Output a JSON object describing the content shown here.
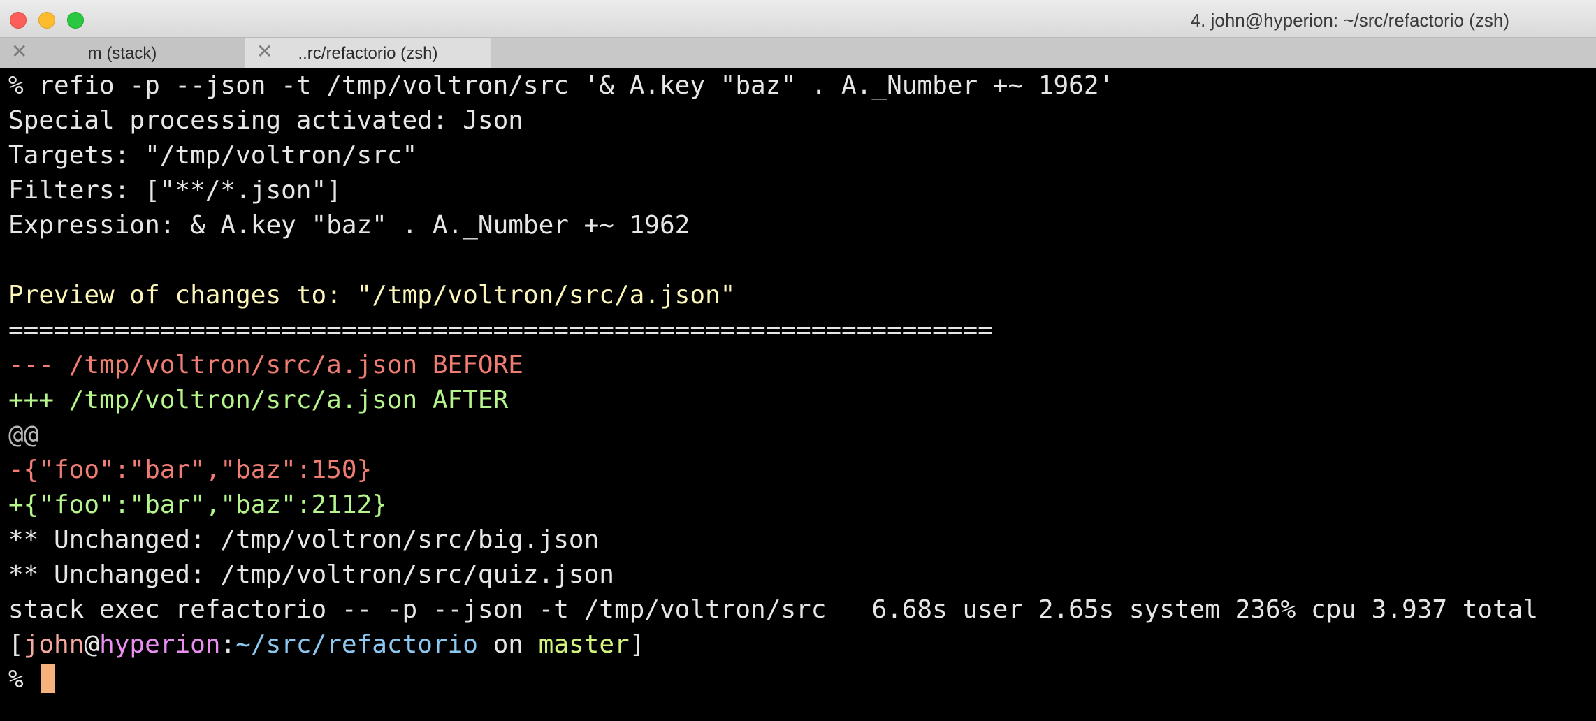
{
  "window": {
    "title": "4. john@hyperion: ~/src/refactorio (zsh)"
  },
  "tabs": [
    {
      "label": "m (stack)",
      "close": "✕"
    },
    {
      "label": "..rc/refactorio (zsh)",
      "close": "✕"
    }
  ],
  "terminal": {
    "lines": [
      "% refio -p --json -t /tmp/voltron/src '& A.key \"baz\" . A._Number +~ 1962'",
      "Special processing activated: Json",
      "Targets: \"/tmp/voltron/src\"",
      "Filters: [\"**/*.json\"]",
      "Expression: & A.key \"baz\" . A._Number +~ 1962",
      "",
      "Preview of changes to: \"/tmp/voltron/src/a.json\"",
      "=================================================================",
      "--- /tmp/voltron/src/a.json BEFORE",
      "+++ /tmp/voltron/src/a.json AFTER",
      "@@",
      "-{\"foo\":\"bar\",\"baz\":150}",
      "+{\"foo\":\"bar\",\"baz\":2112}",
      "** Unchanged: /tmp/voltron/src/big.json",
      "** Unchanged: /tmp/voltron/src/quiz.json",
      "stack exec refactorio -- -p --json -t /tmp/voltron/src   6.68s user 2.65s system 236% cpu 3.937 total"
    ],
    "prompt": {
      "open": "[",
      "user": "john",
      "at": "@",
      "host": "hyperion",
      "sep": ":",
      "path": "~/src/refactorio",
      "on": " on ",
      "branch": "master",
      "close": "]"
    },
    "input_prompt": "% "
  },
  "colors": {
    "background": "#000000",
    "default_text": "#e6e6e6",
    "header_yellow": "#fcf5b8",
    "diff_removed": "#f07d73",
    "diff_added": "#b6f58c",
    "cursor": "#f7b27c"
  }
}
